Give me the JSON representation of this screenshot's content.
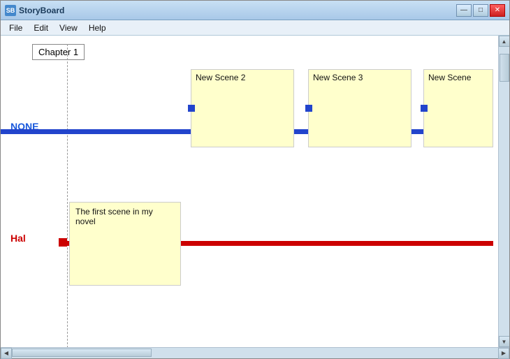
{
  "window": {
    "title": "StoryBoard",
    "icon_label": "SB"
  },
  "title_bar_buttons": {
    "minimize": "—",
    "maximize": "□",
    "close": "✕"
  },
  "menu": {
    "items": [
      "File",
      "Edit",
      "View",
      "Help"
    ]
  },
  "canvas": {
    "chapter_label": "Chapter 1",
    "tracks": {
      "none": {
        "label": "NONE",
        "scenes": [
          {
            "title": "New Scene 2"
          },
          {
            "title": "New Scene 3"
          },
          {
            "title": "New Scene"
          }
        ]
      },
      "hal": {
        "label": "Hal",
        "scene": {
          "text": "The first scene in my novel"
        }
      }
    }
  }
}
